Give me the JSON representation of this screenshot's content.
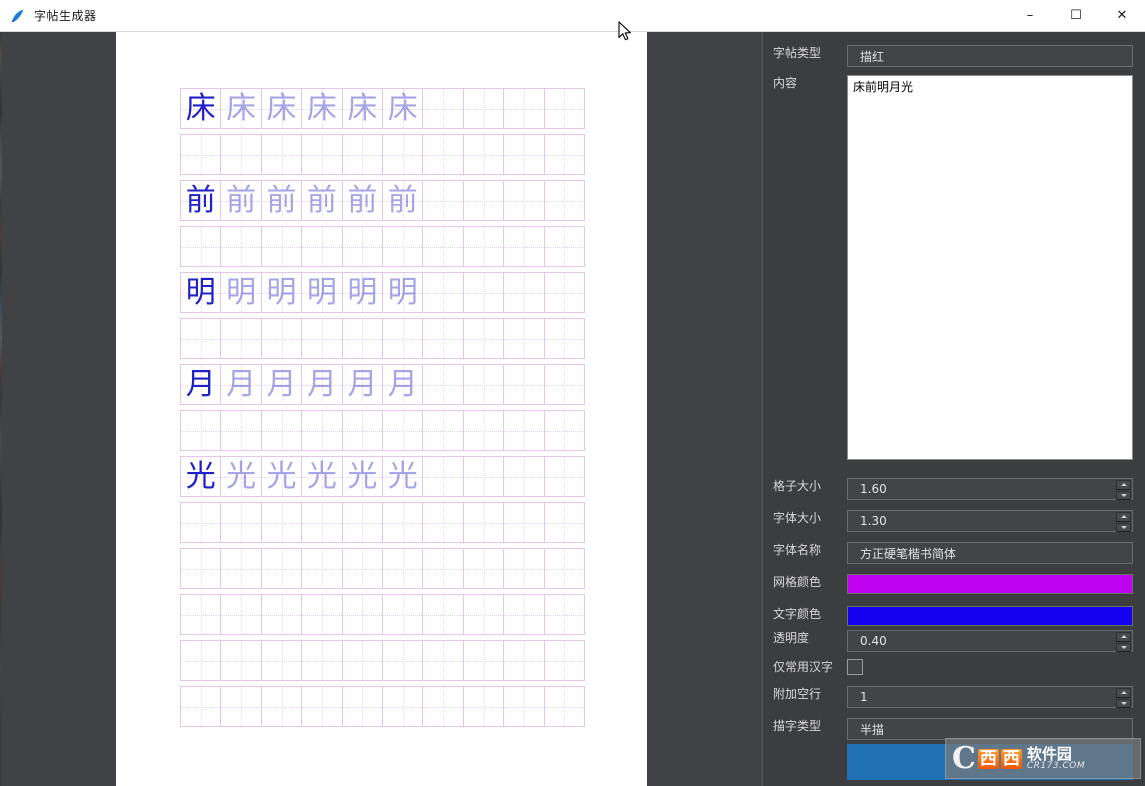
{
  "window": {
    "title": "字帖生成器",
    "icon": "pen-nib-icon",
    "controls": {
      "minimize": "–",
      "maximize": "☐",
      "close": "✕"
    }
  },
  "preview": {
    "name": "copybook-preview",
    "page_background": "#ffffff",
    "grid_color": "#e6c6e8",
    "text_color": "#2020c8",
    "columns": 10,
    "rows": [
      {
        "chars": [
          "床",
          "床",
          "床",
          "床",
          "床",
          "床"
        ],
        "solid_index": 0
      },
      {
        "chars": []
      },
      {
        "chars": [
          "前",
          "前",
          "前",
          "前",
          "前",
          "前"
        ],
        "solid_index": 0
      },
      {
        "chars": []
      },
      {
        "chars": [
          "明",
          "明",
          "明",
          "明",
          "明",
          "明"
        ],
        "solid_index": 0
      },
      {
        "chars": []
      },
      {
        "chars": [
          "月",
          "月",
          "月",
          "月",
          "月",
          "月"
        ],
        "solid_index": 0
      },
      {
        "chars": []
      },
      {
        "chars": [
          "光",
          "光",
          "光",
          "光",
          "光",
          "光"
        ],
        "solid_index": 0
      },
      {
        "chars": []
      },
      {
        "chars": []
      },
      {
        "chars": []
      },
      {
        "chars": []
      },
      {
        "chars": []
      }
    ]
  },
  "settings": {
    "copybook_type": {
      "label": "字帖类型",
      "value": "描红"
    },
    "content": {
      "label": "内容",
      "value": "床前明月光"
    },
    "cell_size": {
      "label": "格子大小",
      "value": "1.60"
    },
    "font_size": {
      "label": "字体大小",
      "value": "1.30"
    },
    "font_name": {
      "label": "字体名称",
      "value": "方正硬笔楷书简体"
    },
    "grid_color": {
      "label": "网格颜色",
      "value": "#bf00f0"
    },
    "text_color": {
      "label": "文字颜色",
      "value": "#1500f0"
    },
    "opacity": {
      "label": "透明度",
      "value": "0.40"
    },
    "common_chars_only": {
      "label": "仅常用汉字",
      "checked": false
    },
    "extra_blank_rows": {
      "label": "附加空行",
      "value": "1"
    },
    "trace_type": {
      "label": "描字类型",
      "value": "半描"
    },
    "generate_button": {
      "label": ""
    }
  },
  "watermark": {
    "mark_c": "C",
    "box1": "西",
    "box2": "西",
    "cn": "软件园",
    "url": "CR173.COM"
  }
}
